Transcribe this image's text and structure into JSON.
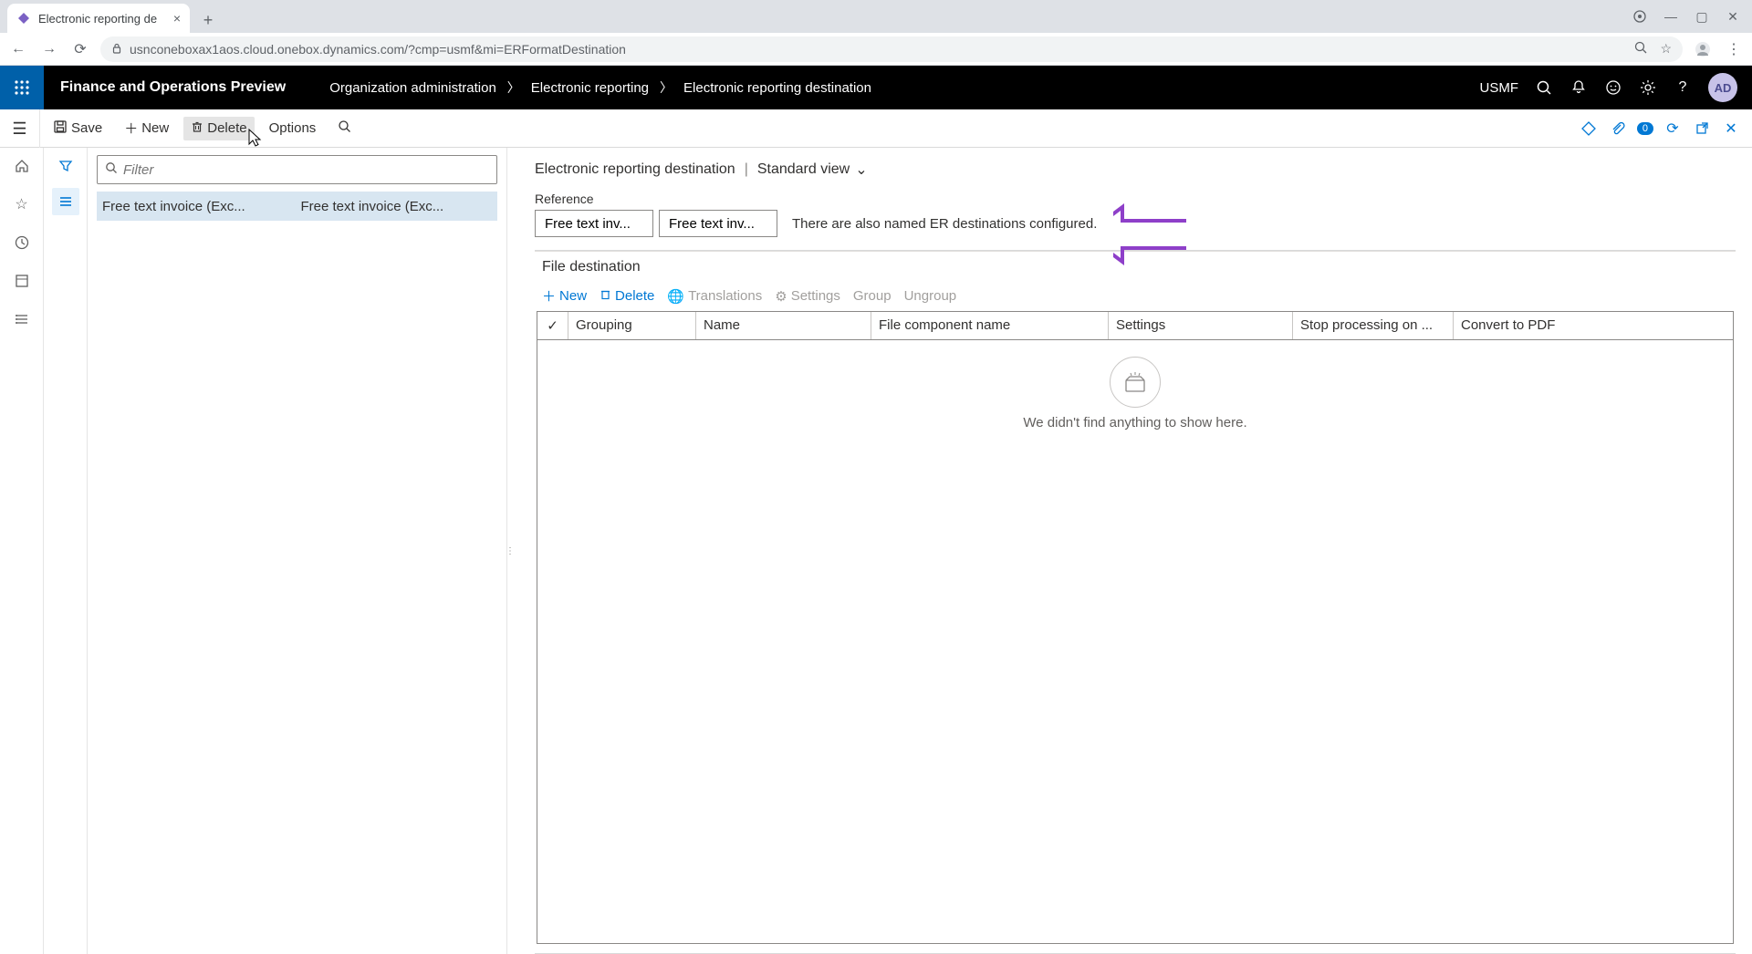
{
  "browser": {
    "tab_title": "Electronic reporting de",
    "url": "usnconeboxax1aos.cloud.onebox.dynamics.com/?cmp=usmf&mi=ERFormatDestination"
  },
  "header": {
    "app_title": "Finance and Operations Preview",
    "breadcrumbs": [
      "Organization administration",
      "Electronic reporting",
      "Electronic reporting destination"
    ],
    "company": "USMF",
    "avatar": "AD"
  },
  "actions": {
    "save": "Save",
    "new": "New",
    "delete": "Delete",
    "options": "Options",
    "badge": "0"
  },
  "sidebar": {
    "filter_placeholder": "Filter",
    "row": {
      "col1": "Free text invoice (Exc...",
      "col2": "Free text invoice (Exc..."
    }
  },
  "content": {
    "title": "Electronic reporting destination",
    "view": "Standard view",
    "reference_label": "Reference",
    "ref1": "Free text inv...",
    "ref2": "Free text inv...",
    "ref_note": "There are also named ER destinations configured."
  },
  "filedest": {
    "title": "File destination",
    "new": "New",
    "delete": "Delete",
    "translations": "Translations",
    "settings": "Settings",
    "group": "Group",
    "ungroup": "Ungroup",
    "cols": {
      "grouping": "Grouping",
      "name": "Name",
      "file_component": "File component name",
      "settings": "Settings",
      "stop": "Stop processing on ...",
      "convert": "Convert to PDF"
    },
    "empty": "We didn't find anything to show here."
  }
}
